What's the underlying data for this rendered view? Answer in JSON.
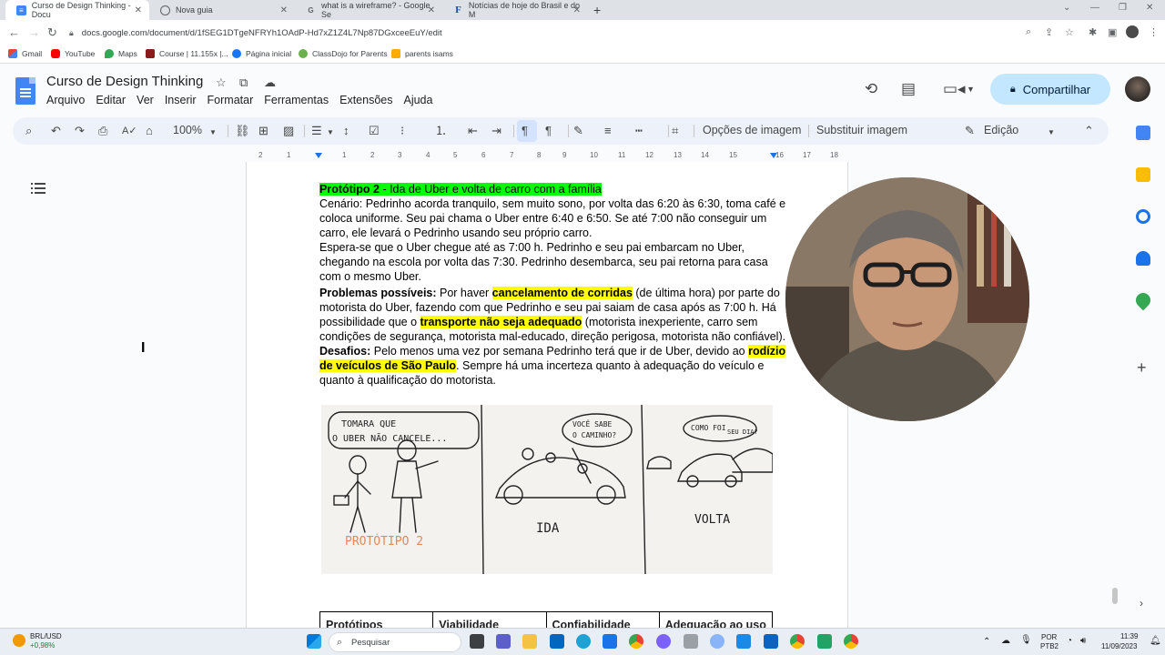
{
  "browser": {
    "tabs": [
      {
        "title": "Curso de Design Thinking - Docu",
        "favicon": "docs-icon"
      },
      {
        "title": "Nova guia",
        "favicon": "chrome-icon"
      },
      {
        "title": "what is a wireframe? - Google Se",
        "favicon": "google-icon"
      },
      {
        "title": "Notícias de hoje do Brasil e do M",
        "favicon": "news-f-icon"
      }
    ],
    "url": "docs.google.com/document/d/1fSEG1DTgeNFRYh1OAdP-Hd7xZ1Z4L7Np87DGxceeEuY/edit",
    "bookmarks": [
      "Gmail",
      "YouTube",
      "Maps",
      "Course | 11.155x |...",
      "Página inicial",
      "ClassDojo for Parents",
      "parents isams"
    ]
  },
  "doc": {
    "title": "Curso de Design Thinking",
    "menu": [
      "Arquivo",
      "Editar",
      "Ver",
      "Inserir",
      "Formatar",
      "Ferramentas",
      "Extensões",
      "Ajuda"
    ],
    "share_label": "Compartilhar",
    "toolbar": {
      "zoom": "100%",
      "image_options": "Opções de imagem",
      "replace_image": "Substituir imagem",
      "mode": "Edição"
    },
    "ruler_ticks": [
      "2",
      "1",
      "1",
      "2",
      "3",
      "4",
      "5",
      "6",
      "7",
      "8",
      "9",
      "10",
      "11",
      "12",
      "13",
      "14",
      "15",
      "16",
      "17",
      "18"
    ]
  },
  "content": {
    "heading": {
      "label": "Protótipo 2",
      "rest": " - Ida de Uber e volta de carro com a família"
    },
    "lines": [
      "Cenário: Pedrinho acorda tranquilo, sem muito sono, por volta das 6:20 às 6:30, toma café e",
      "coloca uniforme.  Seu pai chama o Uber entre 6:40 e 6:50. Se até 7:00 não conseguir um",
      "carro, ele levará o Pedrinho usando seu próprio carro.",
      "Espera-se que o Uber chegue até as 7:00 h. Pedrinho e seu pai embarcam no Uber,",
      "chegando na escola por volta das 7:30. Pedrinho desembarca, seu pai retorna para casa",
      "com o mesmo Uber."
    ],
    "problems": {
      "label": "Problemas possíveis:",
      "t1": " Por haver ",
      "hl1": "cancelamento de corridas",
      "t2": " (de última hora) por parte do",
      "line2": "motorista do Uber, fazendo com que Pedrinho e seu pai saiam de casa após as 7:00 h. Há",
      "t3": "possibilidade que o ",
      "hl2": "transporte não seja adequado",
      "t4": " (motorista inexperiente, carro sem",
      "line4": "condições de segurança, motorista mal-educado, direção perigosa, motorista não confiável)."
    },
    "challenges": {
      "label": "Desafios:",
      "t1": " Pelo menos uma vez por semana Pedrinho terá que ir de Uber, devido ao ",
      "hl1": "rodízio",
      "hl2": "de veículos de São Paulo",
      "t2": ". Sempre há uma incerteza quanto à adequação do veículo e",
      "line3": "quanto à qualificação do motorista."
    },
    "sketch": {
      "bubble1a": "TOMARA QUE",
      "bubble1b": "O UBER NÃO CANCELE...",
      "bubble2a": "VOCÊ SABE",
      "bubble2b": "O CAMINHO?",
      "bubble3a": "COMO FOI",
      "bubble3b": "SEU DIA?",
      "caption1": "PROTÓTIPO 2",
      "caption2": "IDA",
      "caption3": "VOLTA"
    },
    "table_headers": [
      "Protótipos",
      "Viabilidade",
      "Confiabilidade",
      "Adequação ao uso"
    ]
  },
  "taskbar": {
    "weather_label": "BRL/USD",
    "weather_value": "+0,98%",
    "search_placeholder": "Pesquisar",
    "lang1": "POR",
    "lang2": "PTB2",
    "time": "11:39",
    "date": "11/09/2023"
  },
  "colors": {
    "accent": "#c2e7ff",
    "toolbar_bg": "#edf2fa",
    "highlight_green": "#00ff00",
    "highlight_yellow": "#ffff00"
  }
}
